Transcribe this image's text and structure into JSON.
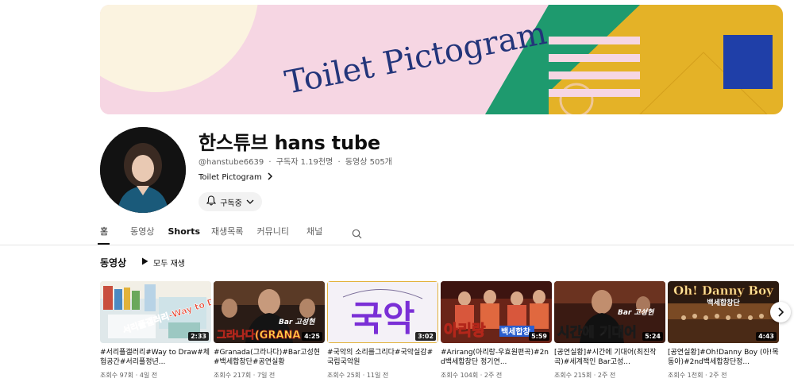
{
  "banner": {
    "title": "Toilet Pictogram"
  },
  "channel": {
    "name": "한스튜브 hans tube",
    "handle": "@hanstube6639",
    "sep": "·",
    "subscribers": "구독자 1.19천명",
    "videos": "동영상 505개",
    "link_label": "Toilet Pictogram",
    "subscribe_label": "구독중"
  },
  "tabs": [
    {
      "label": "홈"
    },
    {
      "label": "동영상"
    },
    {
      "label": "Shorts"
    },
    {
      "label": "재생목록"
    },
    {
      "label": "커뮤니티"
    },
    {
      "label": "채널"
    }
  ],
  "section": {
    "title": "동영상",
    "play_all": "모두 재생"
  },
  "videos": [
    {
      "duration": "2:33",
      "title": "#서리플갤러리#Way to Draw#체험공간#서리플정년...",
      "views": "조회수 97회",
      "age": "4일 전",
      "overlay": "서리플갤러리-Way to Draw"
    },
    {
      "duration": "4:25",
      "title": "#Granada(그라나다)#Bar고성현#백세합창단#공연실황",
      "views": "조회수 217회",
      "age": "7일 전",
      "overlay": "그라나다(GRANA",
      "overlay2": "Bar 고성현"
    },
    {
      "duration": "3:02",
      "title": "#국악의 소리를그리다#국악실감#국립국악원",
      "views": "조회수 25회",
      "age": "11일 전",
      "overlay": "국악"
    },
    {
      "duration": "5:59",
      "title": "#Arirang(아리랑-우효원편곡)#2nd백세합창단 정기연...",
      "views": "조회수 104회",
      "age": "2주 전",
      "overlay": "아리랑",
      "overlay2": "백세합창"
    },
    {
      "duration": "5:24",
      "title": "[공연실황]#시간에 기대어(최진작곡)#세계적인 Bar고성...",
      "views": "조회수 215회",
      "age": "2주 전",
      "overlay": "시간에 기대어",
      "overlay2": "Bar 고성현"
    },
    {
      "duration": "4:43",
      "title": "[공연실황]#Oh!Danny Boy (아!목동아)#2nd백세합창단정...",
      "views": "조회수 1천회",
      "age": "2주 전",
      "overlay": "Oh! Danny Boy",
      "overlay2": "백세합창단"
    }
  ],
  "icons": {
    "bell": "bell-icon",
    "chevron": "chevron-down-icon",
    "link_arrow": "chevron-right-icon",
    "search": "search-icon",
    "play": "play-icon",
    "next": "chevron-right-icon"
  },
  "colors": {
    "banner_pink": "#f6d6e3",
    "banner_green": "#1e9a6e",
    "banner_yellow": "#e4b227",
    "banner_blue": "#1f3fa8",
    "title_blue": "#23357a"
  }
}
